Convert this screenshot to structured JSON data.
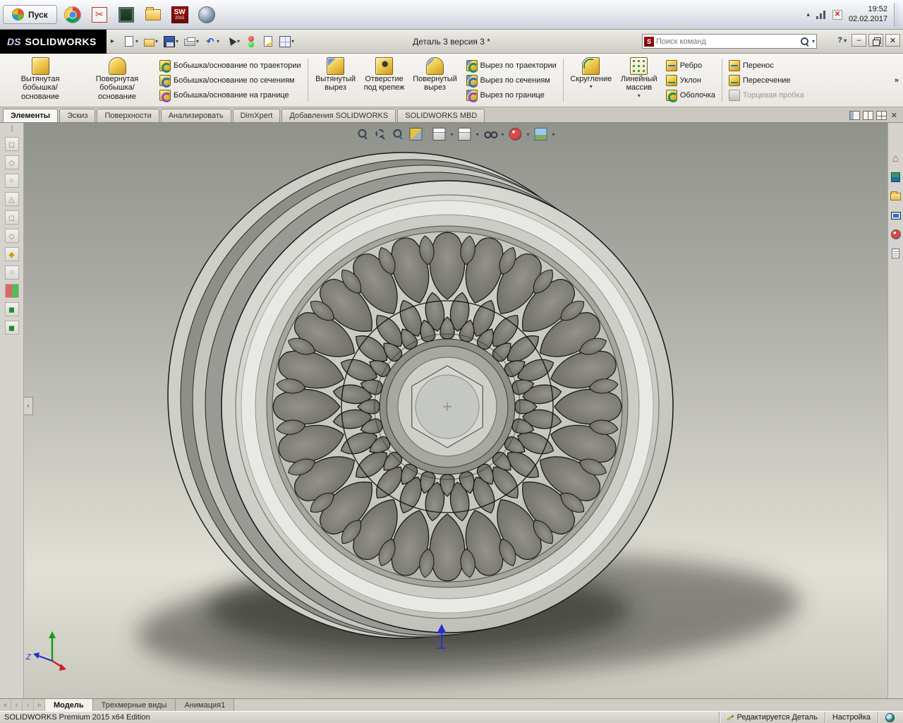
{
  "taskbar": {
    "start_label": "Пуск",
    "time": "19:52",
    "date": "02.02.2017"
  },
  "titlebar": {
    "brand_prefix": "DS",
    "brand": "SOLIDWORKS",
    "document_title": "Деталь 3 версия 3 *",
    "search_placeholder": "Поиск команд"
  },
  "cm_tabs": {
    "items": [
      {
        "label": "Элементы",
        "active": true
      },
      {
        "label": "Эскиз"
      },
      {
        "label": "Поверхности"
      },
      {
        "label": "Анализировать"
      },
      {
        "label": "DimXpert"
      },
      {
        "label": "Добавления SOLIDWORKS"
      },
      {
        "label": "SOLIDWORKS MBD"
      }
    ]
  },
  "ribbon": {
    "big_buttons": [
      {
        "label": "Вытянутая бобышка/основание"
      },
      {
        "label": "Повернутая бобышка/основание"
      },
      {
        "label": "Вытянутый вырез"
      },
      {
        "label": "Отверстие под крепеж"
      },
      {
        "label": "Повернутый вырез"
      },
      {
        "label": "Скругление"
      },
      {
        "label": "Линейный массив"
      }
    ],
    "small_buttons": [
      {
        "label": "Бобышка/основание по траектории"
      },
      {
        "label": "Бобышка/основание по сечениям"
      },
      {
        "label": "Бобышка/основание на границе"
      },
      {
        "label": "Вырез по траектории"
      },
      {
        "label": "Вырез по сечениям"
      },
      {
        "label": "Вырез по границе"
      },
      {
        "label": "Ребро"
      },
      {
        "label": "Уклон"
      },
      {
        "label": "Оболочка"
      },
      {
        "label": "Перенос"
      },
      {
        "label": "Пересечение"
      },
      {
        "label": "Торцевая пробка",
        "disabled": true
      }
    ]
  },
  "viewport": {
    "triad_z_label": "Z"
  },
  "bottom_tabs": {
    "items": [
      {
        "label": "Модель",
        "active": true
      },
      {
        "label": "Трехмерные виды"
      },
      {
        "label": "Анимация1"
      }
    ]
  },
  "statusbar": {
    "left": "SOLIDWORKS Premium 2015 x64 Edition",
    "editing": "Редактируется Деталь",
    "settings": "Настройка"
  },
  "glyphs": {
    "dropdown": "▾",
    "brand_arrow": "▸",
    "overflow": "»",
    "help": "?",
    "minimize": "–",
    "close": "✕",
    "home": "⌂",
    "nav_first": "«",
    "nav_prev": "‹",
    "nav_next": "›",
    "nav_last": "»",
    "panel_collapse": "‹",
    "tray_chevron": "▴",
    "undo": "↶",
    "snip": "✂"
  }
}
